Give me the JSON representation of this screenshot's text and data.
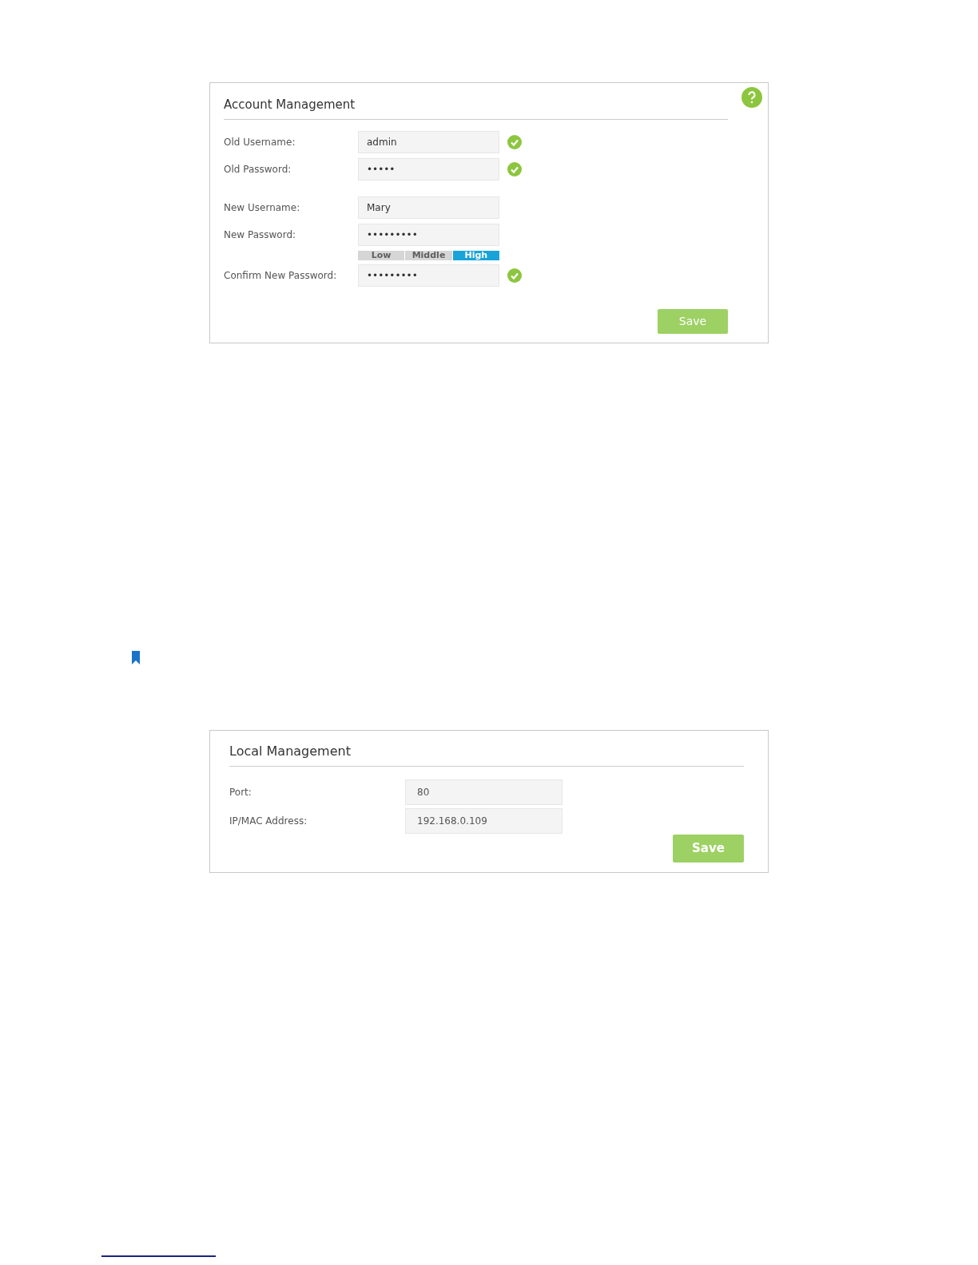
{
  "account_management": {
    "title": "Account Management",
    "fields": [
      {
        "label": "Old Username:",
        "value": "admin",
        "valid": true,
        "kind": "text"
      },
      {
        "label": "Old Password:",
        "value": "•••••",
        "valid": true,
        "kind": "text"
      },
      {
        "label": "New Username:",
        "value": "Mary",
        "valid": false,
        "kind": "text"
      },
      {
        "label": "New Password:",
        "value": "•••••••••",
        "valid": false,
        "kind": "text"
      },
      {
        "kind": "strength",
        "segments": [
          {
            "label": "Low",
            "selected": false
          },
          {
            "label": "Middle",
            "selected": false
          },
          {
            "label": "High",
            "selected": true
          }
        ]
      },
      {
        "label": "Confirm New Password:",
        "value": "•••••••••",
        "valid": true,
        "kind": "text"
      }
    ],
    "save_button": "Save"
  },
  "local_management": {
    "title": "Local Management",
    "fields": [
      {
        "label": "Port:",
        "value": "80"
      },
      {
        "label": "IP/MAC Address:",
        "value": "192.168.0.109"
      }
    ],
    "save_button": "Save"
  }
}
